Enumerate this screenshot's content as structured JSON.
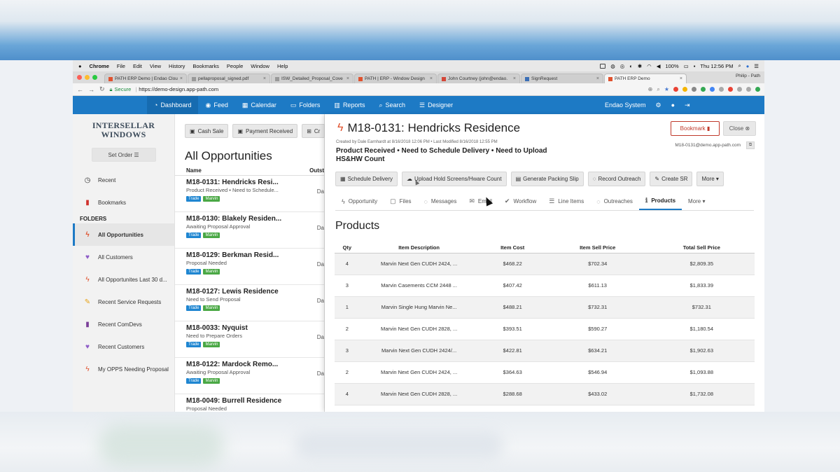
{
  "menubar": {
    "apple": "",
    "items": [
      "Chrome",
      "File",
      "Edit",
      "View",
      "History",
      "Bookmarks",
      "People",
      "Window",
      "Help"
    ],
    "battery": "100%",
    "clock": "Thu 12:56 PM"
  },
  "tabs": [
    {
      "label": "PATH ERP Demo | Endao Clou",
      "active": false
    },
    {
      "label": "pellaproposal_signed.pdf",
      "active": false
    },
    {
      "label": "ISW_Detailed_Proposal_Cove",
      "active": false
    },
    {
      "label": "PATH | ERP - Window Design",
      "active": false
    },
    {
      "label": "John Courtney (john@endao.",
      "active": false
    },
    {
      "label": "SignRequest",
      "active": false
    },
    {
      "label": "PATH ERP Demo",
      "active": true
    }
  ],
  "profile": "Philip - Path",
  "address": {
    "secure": "Secure",
    "url": "https://demo-design.app-path.com"
  },
  "appnav": {
    "items": [
      {
        "icon": "◔",
        "label": "Dashboard",
        "active": true
      },
      {
        "icon": "◉",
        "label": "Feed",
        "active": false
      },
      {
        "icon": "▦",
        "label": "Calendar",
        "active": false
      },
      {
        "icon": "▭",
        "label": "Folders",
        "active": false
      },
      {
        "icon": "▥",
        "label": "Reports",
        "active": false
      },
      {
        "icon": "⌕",
        "label": "Search",
        "active": false
      },
      {
        "icon": "☰",
        "label": "Designer",
        "active": false
      }
    ],
    "system": "Endao System"
  },
  "sidebar": {
    "logo_line1": "INTERSELLAR",
    "logo_line2": "WINDOWS",
    "set_order": "Set Order",
    "recent": "Recent",
    "bookmarks": "Bookmarks",
    "folders_heading": "FOLDERS",
    "folders": [
      {
        "label": "All Opportunities",
        "icon": "ϟ",
        "color": "#e0522e",
        "active": true
      },
      {
        "label": "All Customers",
        "icon": "♥",
        "color": "#8e5cc7",
        "active": false
      },
      {
        "label": "All Opportunites Last 30 d...",
        "icon": "ϟ",
        "color": "#e0522e",
        "active": false
      },
      {
        "label": "Recent Service Requests",
        "icon": "✎",
        "color": "#e8a317",
        "active": false
      },
      {
        "label": "Recent ComDevs",
        "icon": "▮",
        "color": "#7b3f98",
        "active": false
      },
      {
        "label": "Recent Customers",
        "icon": "♥",
        "color": "#8e5cc7",
        "active": false
      },
      {
        "label": "My OPPS Needing Proposal",
        "icon": "ϟ",
        "color": "#e0522e",
        "active": false
      }
    ]
  },
  "list": {
    "cash_sale": "Cash Sale",
    "payment_received": "Payment Received",
    "third_btn": "Cr",
    "title": "All Opportunities",
    "col_name": "Name",
    "col_status": "Outst",
    "rows": [
      {
        "title": "M18-0131: Hendricks Resi...",
        "sub": "Product Received • Need to Schedule...",
        "due": "Da"
      },
      {
        "title": "M18-0130: Blakely Residen...",
        "sub": "Awaiting Proposal Approval",
        "due": "Da"
      },
      {
        "title": "M18-0129: Berkman Resid...",
        "sub": "Proposal Needed",
        "due": "Da"
      },
      {
        "title": "M18-0127: Lewis Residence",
        "sub": "Need to Send Proposal",
        "due": "Da"
      },
      {
        "title": "M18-0033: Nyquist",
        "sub": "Need to Prepare Orders",
        "due": "Da"
      },
      {
        "title": "M18-0122: Mardock Remo...",
        "sub": "Awaiting Proposal Approval",
        "due": "Da"
      },
      {
        "title": "M18-0049: Burrell Residence",
        "sub": "Proposal Needed",
        "due": ""
      }
    ],
    "tag_trade": "Trade",
    "tag_marvin": "Marvin"
  },
  "detail": {
    "title": "M18-0131: Hendricks Residence",
    "bookmark": "Bookmark",
    "close": "Close",
    "meta": "Created by Dale Earnhardt at 8/16/2018 12:06 PM • Last Modified 8/16/2018 12:55 PM",
    "email": "M18-0131@demo.app-path.com",
    "status": "Product Received • Need to Schedule Delivery • Need to Upload HS&HW Count",
    "actions": [
      {
        "icon": "▦",
        "label": "Schedule Delivery"
      },
      {
        "icon": "☁",
        "label": "Upload Hold Screens/Hware Count"
      },
      {
        "icon": "▤",
        "label": "Generate Packing Slip"
      },
      {
        "icon": "◌",
        "label": "Record Outreach"
      },
      {
        "icon": "✎",
        "label": "Create SR"
      },
      {
        "icon": "",
        "label": "More ▾"
      }
    ],
    "tabs": [
      {
        "icon": "ϟ",
        "label": "Opportunity",
        "active": false
      },
      {
        "icon": "▢",
        "label": "Files",
        "active": false
      },
      {
        "icon": "◌",
        "label": "Messages",
        "active": false
      },
      {
        "icon": "✉",
        "label": "Email",
        "active": false
      },
      {
        "icon": "✔",
        "label": "Workflow",
        "active": false
      },
      {
        "icon": "☰",
        "label": "Line Items",
        "active": false
      },
      {
        "icon": "◌",
        "label": "Outreaches",
        "active": false
      },
      {
        "icon": "ℹ",
        "label": "Products",
        "active": true
      },
      {
        "icon": "",
        "label": "More ▾",
        "active": false
      }
    ],
    "products_title": "Products",
    "columns": [
      "Qty",
      "Item Description",
      "Item Cost",
      "Item Sell Price",
      "Total Sell Price"
    ],
    "rows": [
      [
        "4",
        "Marvin Next Gen CUDH 2424, ...",
        "$468.22",
        "$702.34",
        "$2,809.35"
      ],
      [
        "3",
        "Marvin Casements CCM 2448 ...",
        "$407.42",
        "$611.13",
        "$1,833.39"
      ],
      [
        "1",
        "Marvin Single Hung Marvin Ne...",
        "$488.21",
        "$732.31",
        "$732.31"
      ],
      [
        "2",
        "Marvin Next Gen CUDH 2828, ...",
        "$393.51",
        "$590.27",
        "$1,180.54"
      ],
      [
        "3",
        "Marvin Next Gen CUDH 2424/...",
        "$422.81",
        "$634.21",
        "$1,902.63"
      ],
      [
        "2",
        "Marvin Next Gen CUDH 2424, ...",
        "$364.63",
        "$546.94",
        "$1,093.88"
      ],
      [
        "4",
        "Marvin Next Gen CUDH 2828, ...",
        "$288.68",
        "$433.02",
        "$1,732.08"
      ]
    ]
  },
  "colors": {
    "brand_blue": "#1d7ac5",
    "bolt_orange": "#e0522e",
    "bookmark_red": "#c0392b",
    "trade_blue": "#1f86d1",
    "marvin_green": "#4aa845"
  }
}
